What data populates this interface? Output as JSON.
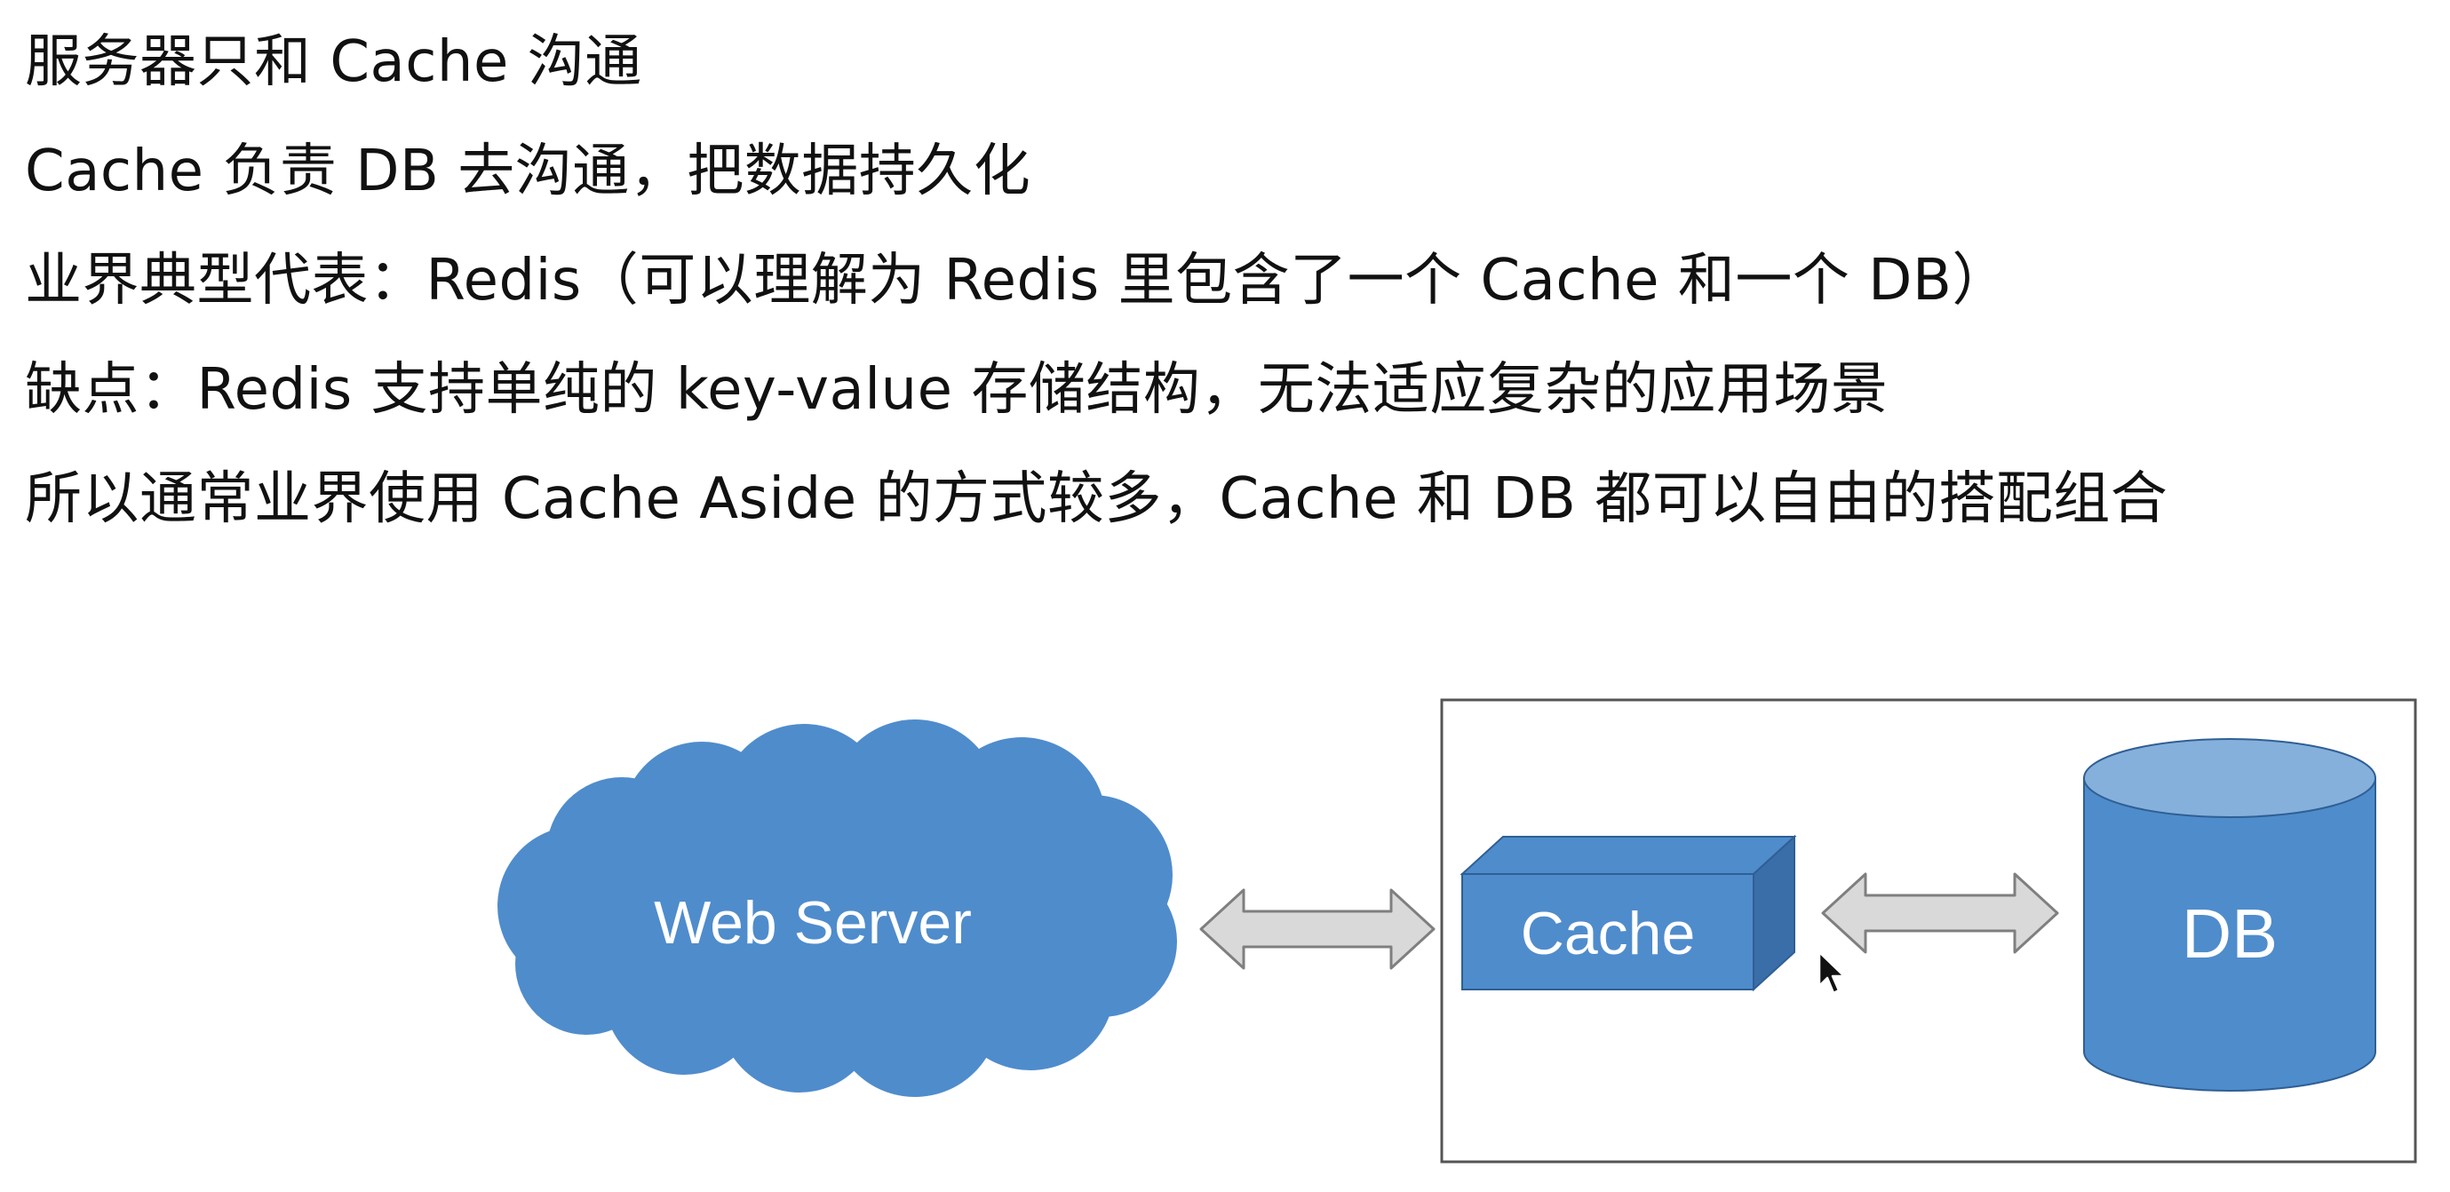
{
  "text_lines": [
    "服务器只和 Cache 沟通",
    "Cache 负责 DB 去沟通，把数据持久化",
    "业界典型代表：Redis（可以理解为 Redis 里包含了一个 Cache 和一个 DB）",
    "缺点：Redis 支持单纯的 key-value 存储结构，无法适应复杂的应用场景",
    "所以通常业界使用 Cache Aside 的方式较多，Cache 和 DB 都可以自由的搭配组合"
  ],
  "diagram": {
    "web_server_label": "Web Server",
    "cache_label": "Cache",
    "db_label": "DB",
    "colors": {
      "shape_fill": "#4f8ccc",
      "shape_dark": "#3a6ea8",
      "cylinder_top": "#86b0dc",
      "arrow_fill": "#d9d9d9",
      "arrow_stroke": "#7f7f7f",
      "frame_stroke": "#555555"
    }
  }
}
